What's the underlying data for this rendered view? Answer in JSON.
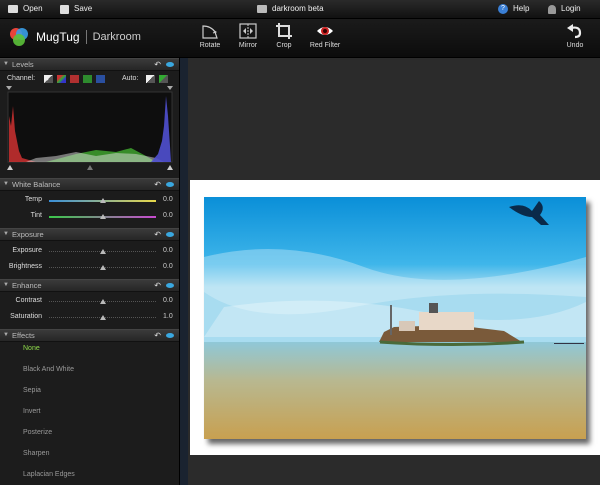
{
  "topbar": {
    "open_label": "Open",
    "save_label": "Save",
    "title": "darkroom beta",
    "help_label": "Help",
    "login_label": "Login"
  },
  "logo": {
    "name": "MugTug",
    "sub": "Darkroom"
  },
  "tools": [
    {
      "label": "Rotate",
      "icon": "rotate-icon"
    },
    {
      "label": "Mirror",
      "icon": "mirror-icon"
    },
    {
      "label": "Crop",
      "icon": "crop-icon"
    },
    {
      "label": "Red Filter",
      "icon": "red-eye-icon"
    },
    {
      "label": "Undo",
      "icon": "undo-icon"
    }
  ],
  "levels": {
    "title": "Levels",
    "channel_label": "Channel:",
    "auto_label": "Auto:",
    "channels": [
      "all",
      "rgb",
      "red",
      "green",
      "blue"
    ],
    "channel_colors": [
      "#555555",
      "#2e8b57",
      "#b03030",
      "#2e8b2e",
      "#2a4fa0"
    ]
  },
  "white_balance": {
    "title": "White Balance",
    "rows": [
      {
        "label": "Temp",
        "value": "0.0",
        "level": 0.5
      },
      {
        "label": "Tint",
        "value": "0.0",
        "level": 0.5
      }
    ]
  },
  "exposure": {
    "title": "Exposure",
    "rows": [
      {
        "label": "Exposure",
        "value": "0.0",
        "level": 0.5
      },
      {
        "label": "Brightness",
        "value": "0.0",
        "level": 0.5
      }
    ]
  },
  "enhance": {
    "title": "Enhance",
    "rows": [
      {
        "label": "Contrast",
        "value": "0.0",
        "level": 0.5
      },
      {
        "label": "Saturation",
        "value": "1.0",
        "level": 0.5
      }
    ]
  },
  "effects": {
    "title": "Effects",
    "items": [
      "None",
      "Black And White",
      "Sepia",
      "Invert",
      "Posterize",
      "Sharpen",
      "Laplacian Edges"
    ],
    "selected": "None"
  },
  "colors": {
    "accent": "#3aa8e0",
    "selected_effect": "#8fdc4a"
  }
}
